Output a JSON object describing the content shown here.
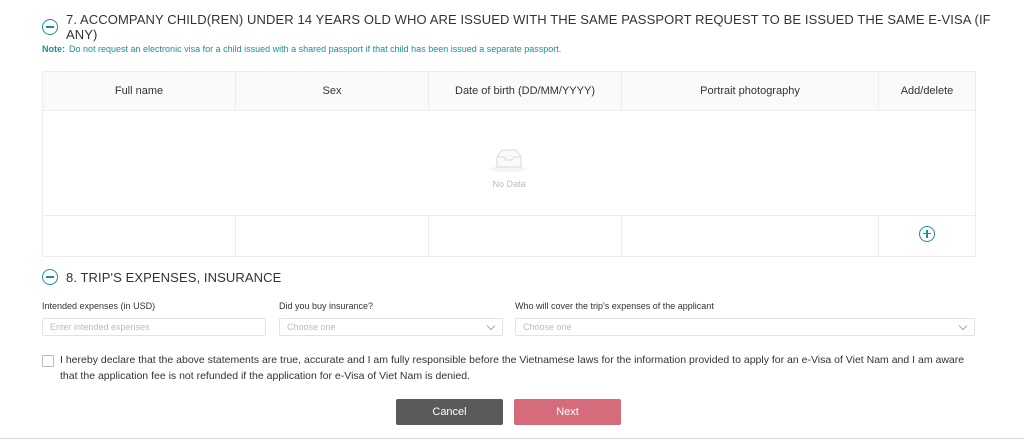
{
  "section7": {
    "title": "7. ACCOMPANY CHILD(REN) UNDER 14 YEARS OLD WHO ARE ISSUED WITH THE SAME PASSPORT REQUEST TO BE ISSUED THE SAME E-VISA (IF ANY)",
    "note_label": "Note:",
    "note_text": "Do not request an electronic visa for a child issued with a shared passport if that child has been issued a separate passport.",
    "columns": [
      "Full name",
      "Sex",
      "Date of birth (DD/MM/YYYY)",
      "Portrait photography",
      "Add/delete"
    ],
    "empty_text": "No Data"
  },
  "section8": {
    "title": "8. TRIP'S EXPENSES, INSURANCE",
    "expenses_label": "Intended expenses (in USD)",
    "expenses_placeholder": "Enter intended expenses",
    "insurance_label": "Did you buy insurance?",
    "insurance_value": "Choose one",
    "cover_label": "Who will cover the trip's expenses of the applicant",
    "cover_value": "Choose one"
  },
  "declaration": "I hereby declare that the above statements are true, accurate and I am fully responsible before the Vietnamese laws for the information provided to apply for an e-Visa of Viet Nam and I am aware that the application fee is not refunded if the application for e-Visa of Viet Nam is denied.",
  "buttons": {
    "cancel": "Cancel",
    "next": "Next"
  },
  "colors": {
    "accent": "#1d8f9a",
    "cancel_bg": "#5a5a5a",
    "next_bg": "#d56b7b"
  }
}
